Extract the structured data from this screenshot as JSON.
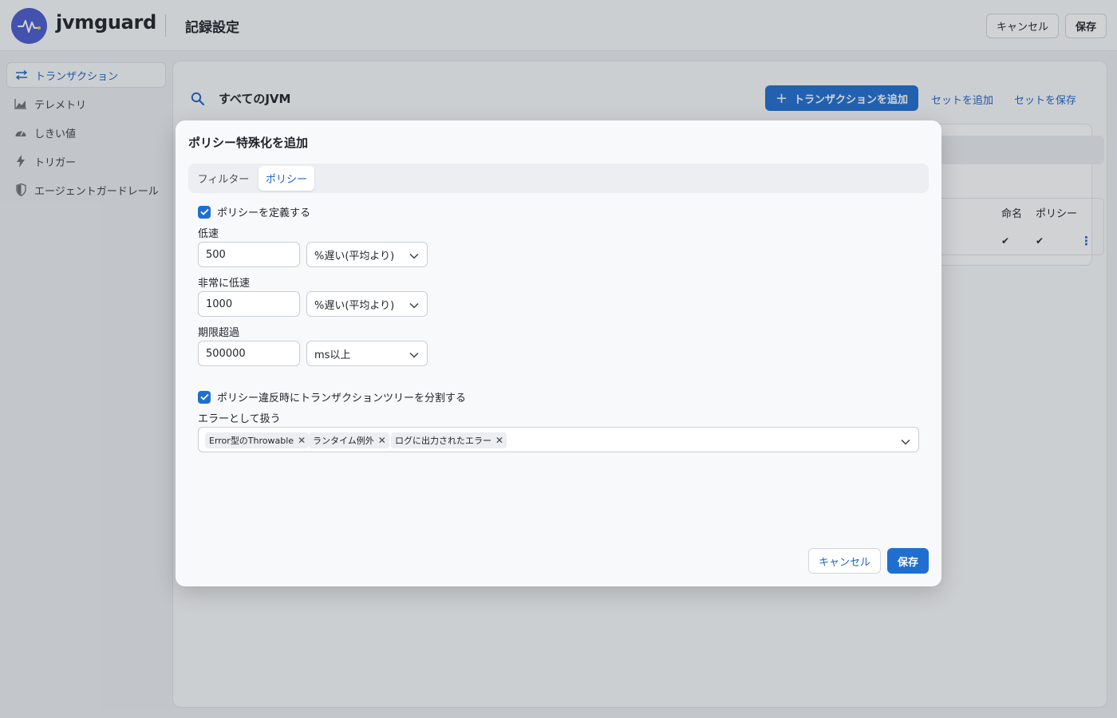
{
  "header": {
    "brand": "jvmguard",
    "page_title": "記録設定",
    "cancel_label": "キャンセル",
    "save_label": "保存"
  },
  "sidebar": {
    "items": [
      {
        "label": "トランザクション",
        "icon": "transactions-icon",
        "active": true
      },
      {
        "label": "テレメトリ",
        "icon": "chart-icon"
      },
      {
        "label": "しきい値",
        "icon": "gauge-icon"
      },
      {
        "label": "トリガー",
        "icon": "lightning-icon"
      },
      {
        "label": "エージェントガードレール",
        "icon": "shield-icon"
      }
    ]
  },
  "main": {
    "scope_title": "すべてのJVM",
    "add_transaction_label": "トランザクションを追加",
    "add_set_label": "セットを追加",
    "save_set_label": "セットを保存",
    "table": {
      "headers": [
        "命名",
        "ポリシー"
      ],
      "row": {
        "naming": "✔",
        "policy": "✔"
      }
    }
  },
  "modal": {
    "title": "ポリシー特殊化を追加",
    "tabs": [
      {
        "label": "フィルター",
        "active": false
      },
      {
        "label": "ポリシー",
        "active": true
      }
    ],
    "define_policy": {
      "label": "ポリシーを定義する",
      "checked": true
    },
    "slow": {
      "label": "低速",
      "value": "500",
      "unit": "%遅い(平均より)"
    },
    "very_slow": {
      "label": "非常に低速",
      "value": "1000",
      "unit": "%遅い(平均より)"
    },
    "overdue": {
      "label": "期限超過",
      "value": "500000",
      "unit": "ms以上"
    },
    "split_tree": {
      "label": "ポリシー違反時にトランザクションツリーを分割する",
      "checked": true
    },
    "treat_as_error": {
      "label": "エラーとして扱う",
      "chips": [
        "Error型のThrowable",
        "ランタイム例外",
        "ログに出力されたエラー"
      ]
    },
    "cancel_label": "キャンセル",
    "save_label": "保存"
  },
  "colors": {
    "accent": "#1f6fd1",
    "logo": "#4b5bcf"
  }
}
